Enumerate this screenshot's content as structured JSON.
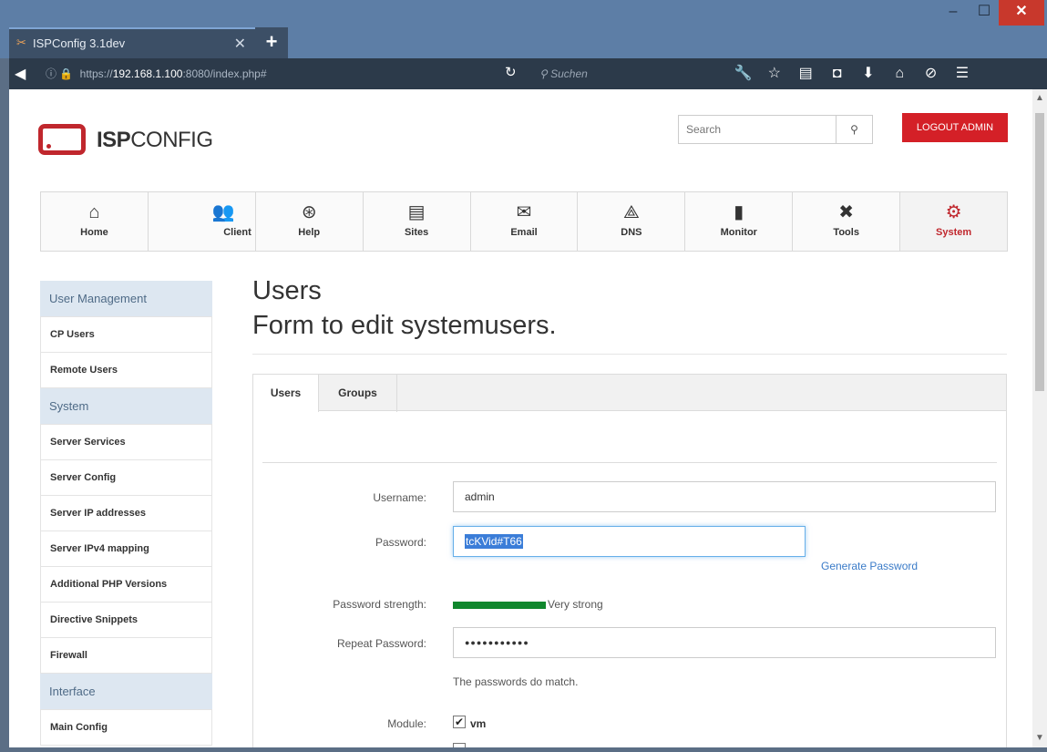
{
  "browser": {
    "tab_title": "ISPConfig 3.1dev",
    "tab_close": "✕",
    "new_tab": "+",
    "url_prefix": "https://",
    "url_host": "192.168.1.100",
    "url_rest": ":8080/index.php#",
    "search_placeholder": "Suchen",
    "window_min": "–",
    "window_max": "☐",
    "window_close": "✕"
  },
  "header": {
    "logo_bold": "ISP",
    "logo_rest": "CONFIG",
    "search_placeholder": "Search",
    "logout_label": "LOGOUT ADMIN"
  },
  "main_nav": [
    {
      "label": "Home",
      "icon": "home-icon"
    },
    {
      "label": "Client",
      "icon": "users-icon"
    },
    {
      "label": "Help",
      "icon": "lifebuoy-icon"
    },
    {
      "label": "Sites",
      "icon": "sites-icon"
    },
    {
      "label": "Email",
      "icon": "email-icon"
    },
    {
      "label": "DNS",
      "icon": "dns-icon"
    },
    {
      "label": "Monitor",
      "icon": "monitor-icon"
    },
    {
      "label": "Tools",
      "icon": "tools-icon"
    },
    {
      "label": "System",
      "icon": "gear-icon",
      "active": true
    }
  ],
  "sidebar": {
    "sections": [
      {
        "title": "User Management",
        "items": [
          "CP Users",
          "Remote Users"
        ]
      },
      {
        "title": "System",
        "items": [
          "Server Services",
          "Server Config",
          "Server IP addresses",
          "Server IPv4 mapping",
          "Additional PHP Versions",
          "Directive Snippets",
          "Firewall"
        ]
      },
      {
        "title": "Interface",
        "items": [
          "Main Config"
        ]
      }
    ]
  },
  "content": {
    "title": "Users",
    "subtitle": "Form to edit systemusers.",
    "tabs": [
      "Users",
      "Groups"
    ],
    "form": {
      "username_label": "Username:",
      "username_value": "admin",
      "password_label": "Password:",
      "password_value": "tcKVid#T66",
      "generate_password": "Generate Password",
      "strength_label": "Password strength:",
      "strength_value": "Very strong",
      "repeat_label": "Repeat Password:",
      "repeat_value": "●●●●●●●●●●●",
      "match_text": "The passwords do match.",
      "module_label": "Module:",
      "module_vm": "vm"
    }
  },
  "colors": {
    "accent_red": "#c0272d",
    "strength_green": "#10872d",
    "link_blue": "#3a7bc8"
  }
}
